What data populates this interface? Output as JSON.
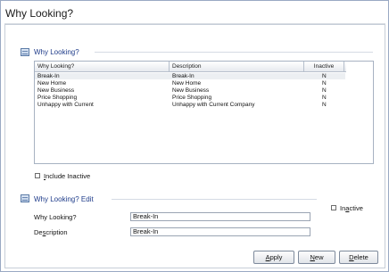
{
  "window": {
    "title": "Why Looking?"
  },
  "list_section": {
    "title": "Why Looking?"
  },
  "grid": {
    "headers": [
      "Why Looking?",
      "Description",
      "Inactive"
    ],
    "rows": [
      [
        "Break-In",
        "Break-In",
        "N"
      ],
      [
        "New Home",
        "New Home",
        "N"
      ],
      [
        "New Business",
        "New Business",
        "N"
      ],
      [
        "Price Shopping",
        "Price Shopping",
        "N"
      ],
      [
        "Unhappy with Current",
        "Unhappy with Current Company",
        "N"
      ]
    ]
  },
  "include_inactive": {
    "label_pre": "",
    "label_u": "I",
    "label_post": "nclude Inactive",
    "checked": false
  },
  "edit_section": {
    "title": "Why Looking? Edit"
  },
  "inactive_checkbox": {
    "label_pre": "In",
    "label_u": "a",
    "label_post": "ctive",
    "checked": false
  },
  "form": {
    "why_label": "Why Looking?",
    "why_value": "Break-In",
    "desc_label_pre": "De",
    "desc_label_u": "s",
    "desc_label_post": "cription",
    "desc_value": "Break-In"
  },
  "buttons": {
    "apply": {
      "u": "A",
      "rest": "pply"
    },
    "new": {
      "u": "N",
      "rest": "ew"
    },
    "delete": {
      "u": "D",
      "rest": "elete"
    }
  }
}
